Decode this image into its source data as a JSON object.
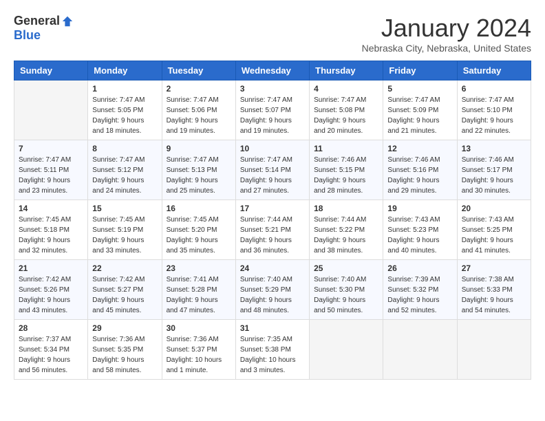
{
  "logo": {
    "general": "General",
    "blue": "Blue"
  },
  "title": "January 2024",
  "subtitle": "Nebraska City, Nebraska, United States",
  "weekdays": [
    "Sunday",
    "Monday",
    "Tuesday",
    "Wednesday",
    "Thursday",
    "Friday",
    "Saturday"
  ],
  "weeks": [
    [
      {
        "day": "",
        "info": ""
      },
      {
        "day": "1",
        "info": "Sunrise: 7:47 AM\nSunset: 5:05 PM\nDaylight: 9 hours\nand 18 minutes."
      },
      {
        "day": "2",
        "info": "Sunrise: 7:47 AM\nSunset: 5:06 PM\nDaylight: 9 hours\nand 19 minutes."
      },
      {
        "day": "3",
        "info": "Sunrise: 7:47 AM\nSunset: 5:07 PM\nDaylight: 9 hours\nand 19 minutes."
      },
      {
        "day": "4",
        "info": "Sunrise: 7:47 AM\nSunset: 5:08 PM\nDaylight: 9 hours\nand 20 minutes."
      },
      {
        "day": "5",
        "info": "Sunrise: 7:47 AM\nSunset: 5:09 PM\nDaylight: 9 hours\nand 21 minutes."
      },
      {
        "day": "6",
        "info": "Sunrise: 7:47 AM\nSunset: 5:10 PM\nDaylight: 9 hours\nand 22 minutes."
      }
    ],
    [
      {
        "day": "7",
        "info": "Sunrise: 7:47 AM\nSunset: 5:11 PM\nDaylight: 9 hours\nand 23 minutes."
      },
      {
        "day": "8",
        "info": "Sunrise: 7:47 AM\nSunset: 5:12 PM\nDaylight: 9 hours\nand 24 minutes."
      },
      {
        "day": "9",
        "info": "Sunrise: 7:47 AM\nSunset: 5:13 PM\nDaylight: 9 hours\nand 25 minutes."
      },
      {
        "day": "10",
        "info": "Sunrise: 7:47 AM\nSunset: 5:14 PM\nDaylight: 9 hours\nand 27 minutes."
      },
      {
        "day": "11",
        "info": "Sunrise: 7:46 AM\nSunset: 5:15 PM\nDaylight: 9 hours\nand 28 minutes."
      },
      {
        "day": "12",
        "info": "Sunrise: 7:46 AM\nSunset: 5:16 PM\nDaylight: 9 hours\nand 29 minutes."
      },
      {
        "day": "13",
        "info": "Sunrise: 7:46 AM\nSunset: 5:17 PM\nDaylight: 9 hours\nand 30 minutes."
      }
    ],
    [
      {
        "day": "14",
        "info": "Sunrise: 7:45 AM\nSunset: 5:18 PM\nDaylight: 9 hours\nand 32 minutes."
      },
      {
        "day": "15",
        "info": "Sunrise: 7:45 AM\nSunset: 5:19 PM\nDaylight: 9 hours\nand 33 minutes."
      },
      {
        "day": "16",
        "info": "Sunrise: 7:45 AM\nSunset: 5:20 PM\nDaylight: 9 hours\nand 35 minutes."
      },
      {
        "day": "17",
        "info": "Sunrise: 7:44 AM\nSunset: 5:21 PM\nDaylight: 9 hours\nand 36 minutes."
      },
      {
        "day": "18",
        "info": "Sunrise: 7:44 AM\nSunset: 5:22 PM\nDaylight: 9 hours\nand 38 minutes."
      },
      {
        "day": "19",
        "info": "Sunrise: 7:43 AM\nSunset: 5:23 PM\nDaylight: 9 hours\nand 40 minutes."
      },
      {
        "day": "20",
        "info": "Sunrise: 7:43 AM\nSunset: 5:25 PM\nDaylight: 9 hours\nand 41 minutes."
      }
    ],
    [
      {
        "day": "21",
        "info": "Sunrise: 7:42 AM\nSunset: 5:26 PM\nDaylight: 9 hours\nand 43 minutes."
      },
      {
        "day": "22",
        "info": "Sunrise: 7:42 AM\nSunset: 5:27 PM\nDaylight: 9 hours\nand 45 minutes."
      },
      {
        "day": "23",
        "info": "Sunrise: 7:41 AM\nSunset: 5:28 PM\nDaylight: 9 hours\nand 47 minutes."
      },
      {
        "day": "24",
        "info": "Sunrise: 7:40 AM\nSunset: 5:29 PM\nDaylight: 9 hours\nand 48 minutes."
      },
      {
        "day": "25",
        "info": "Sunrise: 7:40 AM\nSunset: 5:30 PM\nDaylight: 9 hours\nand 50 minutes."
      },
      {
        "day": "26",
        "info": "Sunrise: 7:39 AM\nSunset: 5:32 PM\nDaylight: 9 hours\nand 52 minutes."
      },
      {
        "day": "27",
        "info": "Sunrise: 7:38 AM\nSunset: 5:33 PM\nDaylight: 9 hours\nand 54 minutes."
      }
    ],
    [
      {
        "day": "28",
        "info": "Sunrise: 7:37 AM\nSunset: 5:34 PM\nDaylight: 9 hours\nand 56 minutes."
      },
      {
        "day": "29",
        "info": "Sunrise: 7:36 AM\nSunset: 5:35 PM\nDaylight: 9 hours\nand 58 minutes."
      },
      {
        "day": "30",
        "info": "Sunrise: 7:36 AM\nSunset: 5:37 PM\nDaylight: 10 hours\nand 1 minute."
      },
      {
        "day": "31",
        "info": "Sunrise: 7:35 AM\nSunset: 5:38 PM\nDaylight: 10 hours\nand 3 minutes."
      },
      {
        "day": "",
        "info": ""
      },
      {
        "day": "",
        "info": ""
      },
      {
        "day": "",
        "info": ""
      }
    ]
  ]
}
